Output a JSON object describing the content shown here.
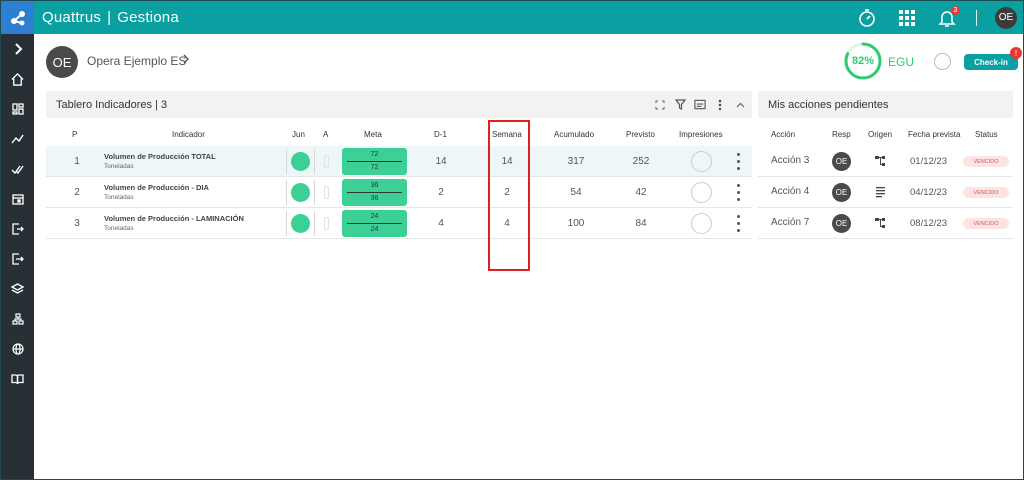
{
  "app": {
    "brand": "Quattrus",
    "module": "Gestiona",
    "separator": "|",
    "notifications_count": "3",
    "user_initials": "OE"
  },
  "unit": {
    "initials": "OE",
    "name": "Opera Ejemplo ES"
  },
  "score": {
    "percent": "82%",
    "fraction": 0.82,
    "label": "EGU",
    "color": "#2ecc71"
  },
  "checkin": {
    "label": "Check-in",
    "badge": "!"
  },
  "tablero": {
    "title": "Tablero Indicadores | 3",
    "columns": {
      "p": "P",
      "indicador": "Indicador",
      "jun": "Jun",
      "a": "A",
      "meta": "Meta",
      "d1": "D-1",
      "semana": "Semana",
      "acumulado": "Acumulado",
      "previsto": "Previsto",
      "impresiones": "Impresiones"
    },
    "rows": [
      {
        "p": "1",
        "name": "Volumen de Producción TOTAL",
        "unit": "Toneladas",
        "meta_top": "72",
        "meta_bottom": "72",
        "d1": "14",
        "semana": "14",
        "acumulado": "317",
        "previsto": "252"
      },
      {
        "p": "2",
        "name": "Volumen de Producción - DIA",
        "unit": "Toneladas",
        "meta_top": "36",
        "meta_bottom": "36",
        "d1": "2",
        "semana": "2",
        "acumulado": "54",
        "previsto": "42"
      },
      {
        "p": "3",
        "name": "Volumen de Producción - LAMINACIÓN",
        "unit": "Toneladas",
        "meta_top": "24",
        "meta_bottom": "24",
        "d1": "4",
        "semana": "4",
        "acumulado": "100",
        "previsto": "84"
      }
    ]
  },
  "acciones": {
    "title": "Mis acciones pendientes",
    "columns": {
      "accion": "Acción",
      "resp": "Resp",
      "origen": "Origen",
      "fecha": "Fecha prevista",
      "status": "Status"
    },
    "rows": [
      {
        "name": "Acción 3",
        "resp": "OE",
        "origen_icon": "hierarchy-icon",
        "fecha": "01/12/23",
        "status": "VENCIDO"
      },
      {
        "name": "Acción 4",
        "resp": "OE",
        "origen_icon": "list-icon",
        "fecha": "04/12/23",
        "status": "VENCIDO"
      },
      {
        "name": "Acción 7",
        "resp": "OE",
        "origen_icon": "hierarchy-icon",
        "fecha": "08/12/23",
        "status": "VENCIDO"
      }
    ]
  },
  "colors": {
    "topbar": "#0a9fa1",
    "sidebar": "#283036",
    "meta_green": "#3ccf96",
    "status_red": "#e05050"
  }
}
